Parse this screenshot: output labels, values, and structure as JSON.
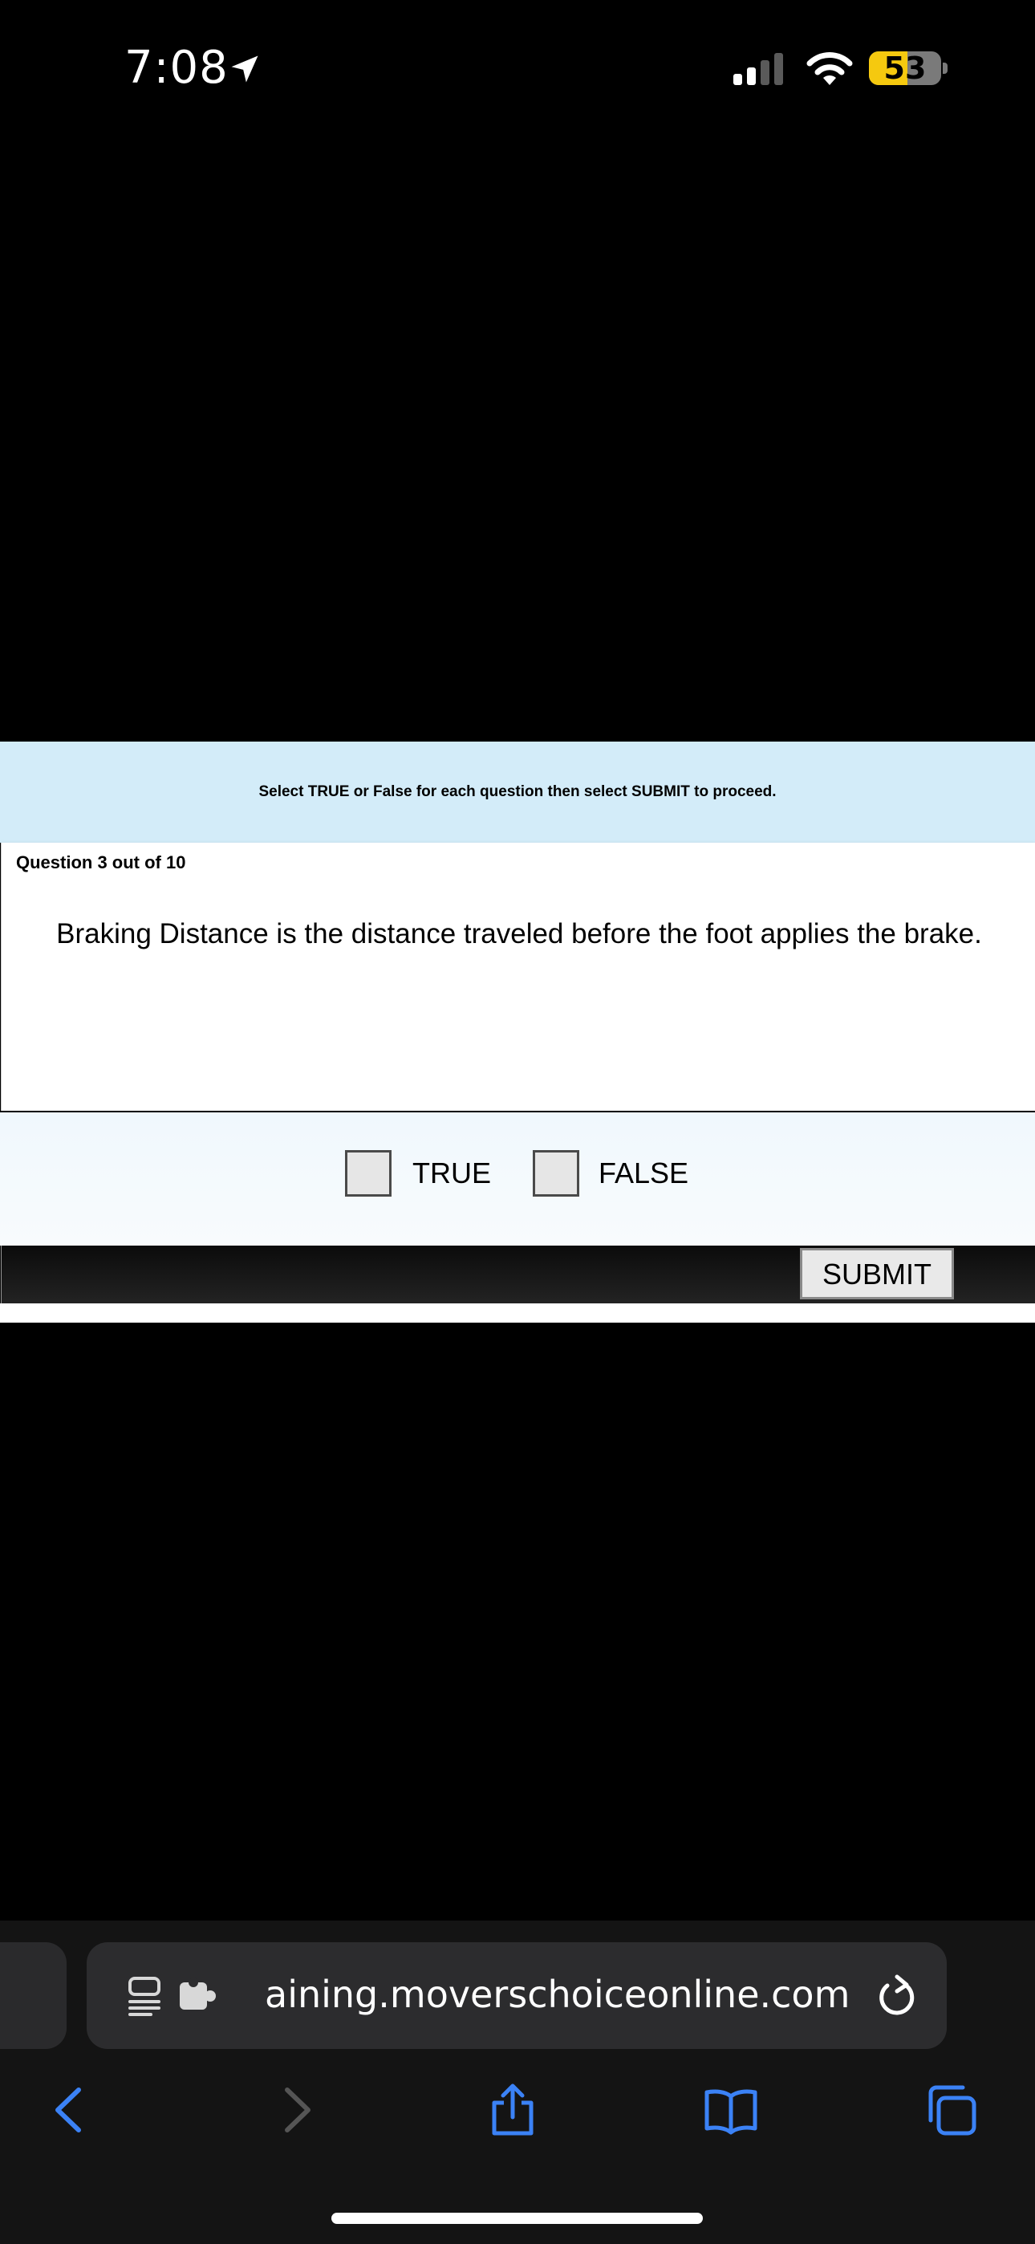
{
  "status_bar": {
    "time": "7:08",
    "battery_level": "53",
    "location_icon": "location-arrow-icon",
    "signal_icon": "cellular-signal-icon",
    "wifi_icon": "wifi-icon",
    "colors": {
      "battery_fill": "#f5c90f"
    }
  },
  "quiz": {
    "instructions": "Select TRUE or False for each question then select SUBMIT to proceed.",
    "question_counter": "Question 3 out of 10",
    "question_text": "Braking Distance is the distance traveled before the foot applies the brake.",
    "options": [
      {
        "label": "TRUE",
        "checked": false
      },
      {
        "label": "FALSE",
        "checked": false
      }
    ],
    "submit_label": "SUBMIT",
    "colors": {
      "instructions_bg": "#d3ecf9",
      "footer_bg": "#111111"
    }
  },
  "browser": {
    "url": "aining.moverschoiceonline.com",
    "icons": [
      "reader-icon",
      "extension-icon",
      "reload-icon",
      "back-icon",
      "forward-icon",
      "share-icon",
      "bookmarks-icon",
      "tabs-icon"
    ],
    "colors": {
      "accent": "#3b82f6"
    }
  }
}
